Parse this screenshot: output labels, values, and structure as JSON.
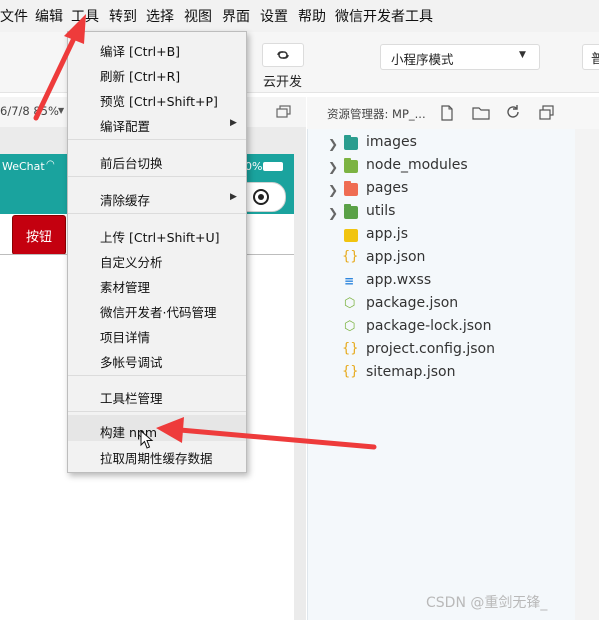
{
  "menubar": {
    "items": [
      "文件",
      "编辑",
      "工具",
      "转到",
      "选择",
      "视图",
      "界面",
      "设置",
      "帮助",
      "微信开发者工具"
    ]
  },
  "toolbar": {
    "cloud_label": "云开发",
    "mode_select": "小程序模式",
    "right_cut_label": "普"
  },
  "simulator": {
    "device_label": "6/7/8 85%",
    "status_app": "WeChat",
    "battery": "0%",
    "demo_button": "按钮"
  },
  "tools_menu": {
    "items": [
      {
        "label": "编译  [Ctrl+B]"
      },
      {
        "label": "刷新  [Ctrl+R]"
      },
      {
        "label": "预览  [Ctrl+Shift+P]"
      },
      {
        "label": "编译配置",
        "submenu": true
      },
      {
        "label": "前后台切换"
      },
      {
        "label": "清除缓存",
        "submenu": true
      },
      {
        "label": "上传  [Ctrl+Shift+U]"
      },
      {
        "label": "自定义分析"
      },
      {
        "label": "素材管理"
      },
      {
        "label": "微信开发者·代码管理"
      },
      {
        "label": "项目详情"
      },
      {
        "label": "多帐号调试"
      },
      {
        "label": "工具栏管理"
      },
      {
        "label": "构建 npm",
        "highlighted": true
      },
      {
        "label": "拉取周期性缓存数据"
      }
    ]
  },
  "explorer": {
    "title": "资源管理器: MP_...",
    "tree": [
      {
        "name": "images",
        "type": "folder",
        "icon": "folder-images-icon",
        "color": "#2a9d8f"
      },
      {
        "name": "node_modules",
        "type": "folder",
        "icon": "folder-node-icon",
        "color": "#7cb342"
      },
      {
        "name": "pages",
        "type": "folder",
        "icon": "folder-pages-icon",
        "color": "#ef6c52"
      },
      {
        "name": "utils",
        "type": "folder",
        "icon": "folder-utils-icon",
        "color": "#5aa147"
      },
      {
        "name": "app.js",
        "type": "file",
        "icon": "js-file-icon",
        "color": "#f1c40f"
      },
      {
        "name": "app.json",
        "type": "file",
        "icon": "json-file-icon",
        "color": "#e6a817"
      },
      {
        "name": "app.wxss",
        "type": "file",
        "icon": "css-file-icon",
        "color": "#2e86de"
      },
      {
        "name": "package.json",
        "type": "file",
        "icon": "node-file-icon",
        "color": "#7cb342"
      },
      {
        "name": "package-lock.json",
        "type": "file",
        "icon": "node-file-icon",
        "color": "#7cb342"
      },
      {
        "name": "project.config.json",
        "type": "file",
        "icon": "json-file-icon",
        "color": "#e6a817"
      },
      {
        "name": "sitemap.json",
        "type": "file",
        "icon": "json-file-icon",
        "color": "#e6a817"
      }
    ]
  },
  "watermark": "CSDN @重剑无锋_",
  "colors": {
    "arrow": "#ee3b3b",
    "status_bar": "#1aa39e",
    "demo_button": "#c4000f"
  }
}
